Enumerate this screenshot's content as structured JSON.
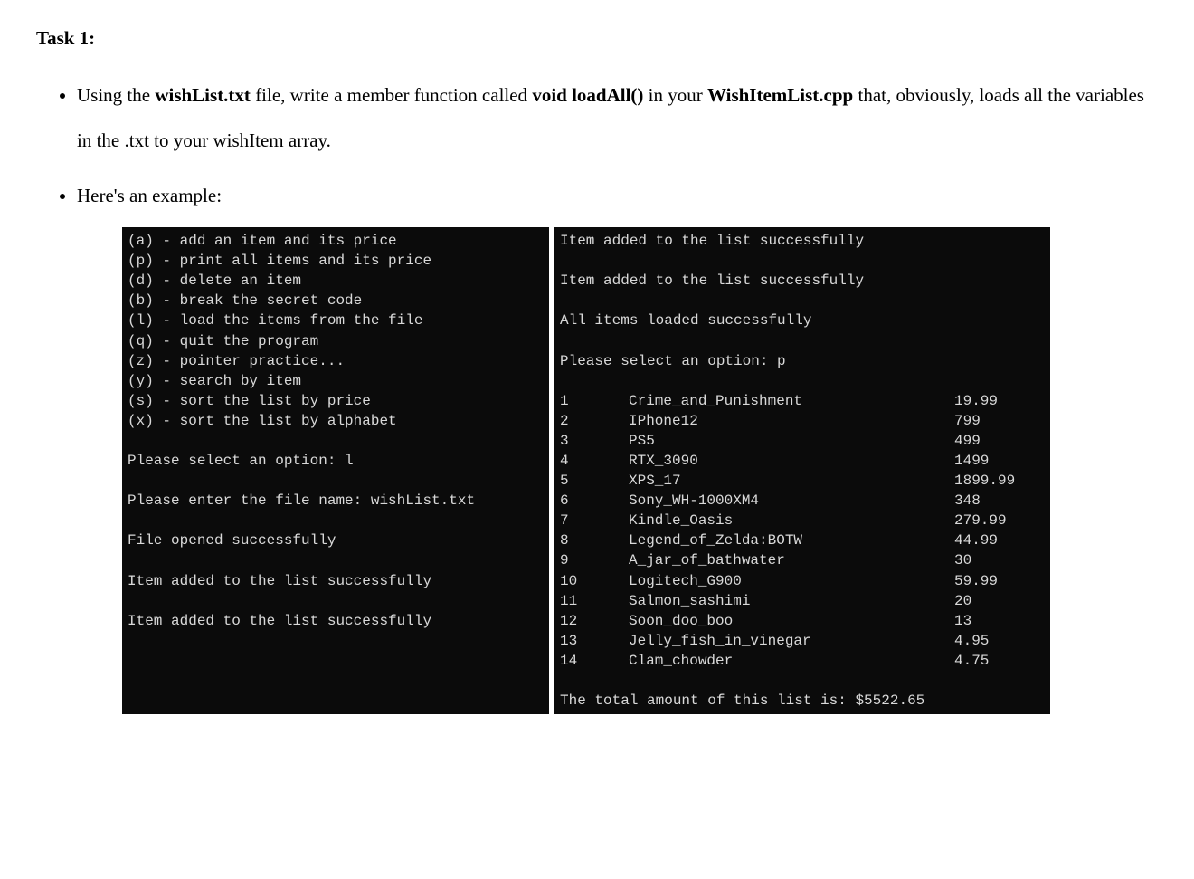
{
  "heading": "Task 1:",
  "bullet1": {
    "pre": "Using the ",
    "f1": "wishList.txt",
    "mid1": " file, write a member function called ",
    "f2": "void loadAll()",
    "mid2": " in your ",
    "f3": "WishItemList.cpp",
    "post": " that, obviously, loads all the variables in the .txt to your wishItem array."
  },
  "bullet2": "Here's an example:",
  "term_left": {
    "menu": [
      "(a) - add an item and its price",
      "(p) - print all items and its price",
      "(d) - delete an item",
      "(b) - break the secret code",
      "(l) - load the items from the file",
      "(q) - quit the program",
      "(z) - pointer practice...",
      "(y) - search by item",
      "(s) - sort the list by price",
      "(x) - sort the list by alphabet"
    ],
    "prompt_option": "Please select an option: l",
    "prompt_file": "Please enter the file name: wishList.txt",
    "file_opened": "File opened successfully",
    "added1": "Item added to the list successfully",
    "added2": "Item added to the list successfully"
  },
  "term_right": {
    "added3": "Item added to the list successfully",
    "added4": "Item added to the list successfully",
    "all_loaded": "All items loaded successfully",
    "prompt_option": "Please select an option: p",
    "items": [
      {
        "idx": "1",
        "name": "Crime_and_Punishment",
        "price": "19.99"
      },
      {
        "idx": "2",
        "name": "IPhone12",
        "price": "799"
      },
      {
        "idx": "3",
        "name": "PS5",
        "price": "499"
      },
      {
        "idx": "4",
        "name": "RTX_3090",
        "price": "1499"
      },
      {
        "idx": "5",
        "name": "XPS_17",
        "price": "1899.99"
      },
      {
        "idx": "6",
        "name": "Sony_WH-1000XM4",
        "price": "348"
      },
      {
        "idx": "7",
        "name": "Kindle_Oasis",
        "price": "279.99"
      },
      {
        "idx": "8",
        "name": "Legend_of_Zelda:BOTW",
        "price": "44.99"
      },
      {
        "idx": "9",
        "name": "A_jar_of_bathwater",
        "price": "30"
      },
      {
        "idx": "10",
        "name": "Logitech_G900",
        "price": "59.99"
      },
      {
        "idx": "11",
        "name": "Salmon_sashimi",
        "price": "20"
      },
      {
        "idx": "12",
        "name": "Soon_doo_boo",
        "price": "13"
      },
      {
        "idx": "13",
        "name": "Jelly_fish_in_vinegar",
        "price": "4.95"
      },
      {
        "idx": "14",
        "name": "Clam_chowder",
        "price": "4.75"
      }
    ],
    "total": "The total amount of this list is: $5522.65"
  }
}
